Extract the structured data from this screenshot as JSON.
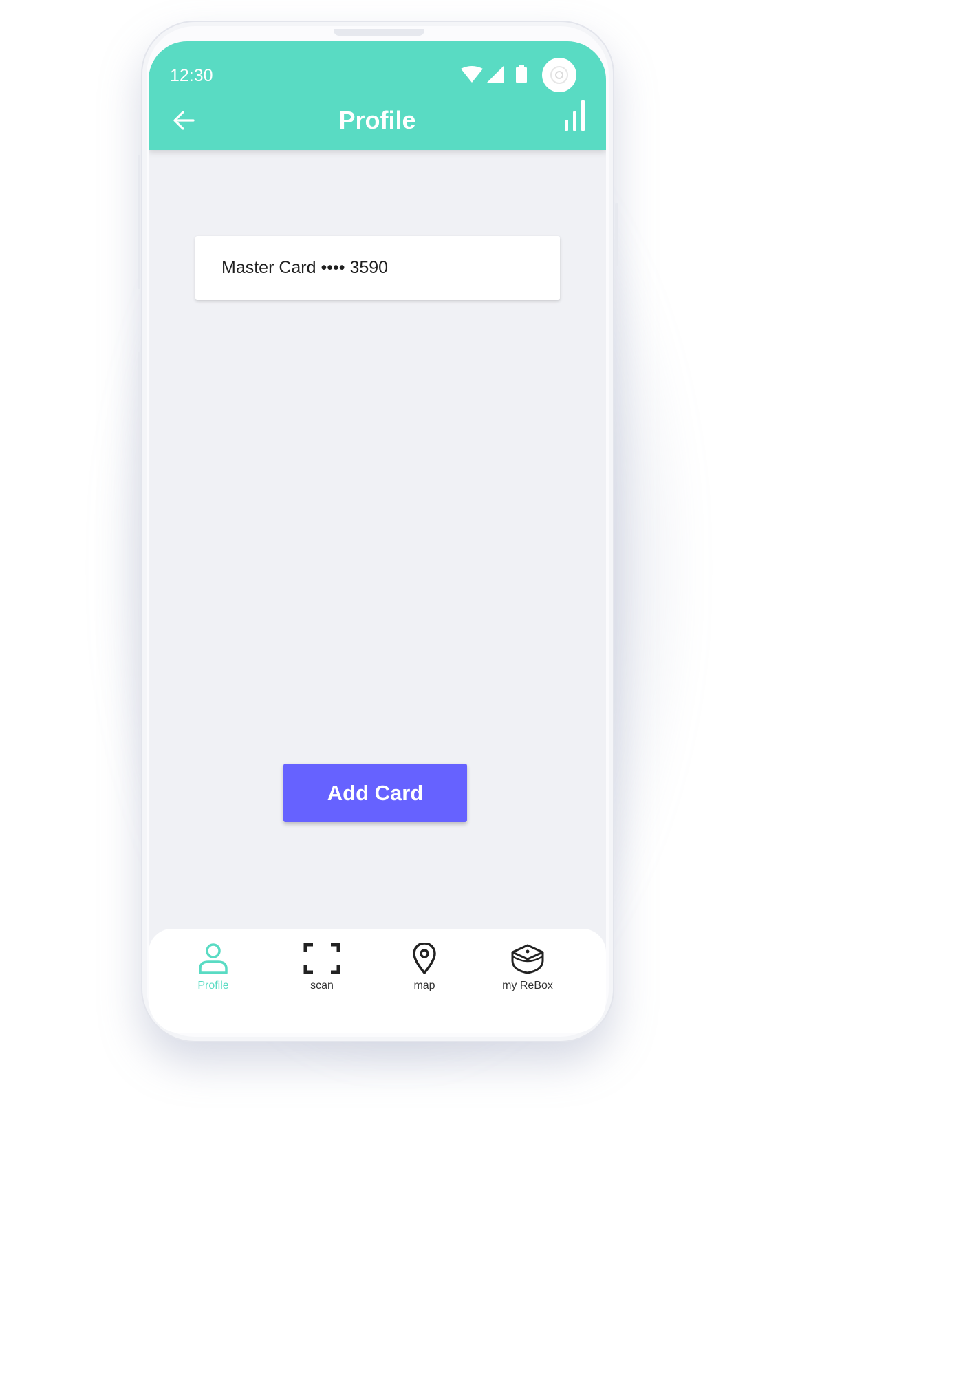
{
  "status_bar": {
    "time": "12:30"
  },
  "header": {
    "title": "Profile"
  },
  "cards": [
    {
      "label": "Master Card •••• 3590"
    }
  ],
  "actions": {
    "add_card_label": "Add Card"
  },
  "bottom_nav": {
    "items": [
      {
        "label": "Profile",
        "icon": "person-icon",
        "active": true
      },
      {
        "label": "scan",
        "icon": "scan-icon",
        "active": false
      },
      {
        "label": "map",
        "icon": "map-pin-icon",
        "active": false
      },
      {
        "label": "my ReBox",
        "icon": "box-icon",
        "active": false
      }
    ]
  },
  "colors": {
    "header_bg": "#59dbc3",
    "accent": "#59dbc3",
    "primary_button": "#6662ff",
    "screen_bg": "#f0f1f5"
  }
}
